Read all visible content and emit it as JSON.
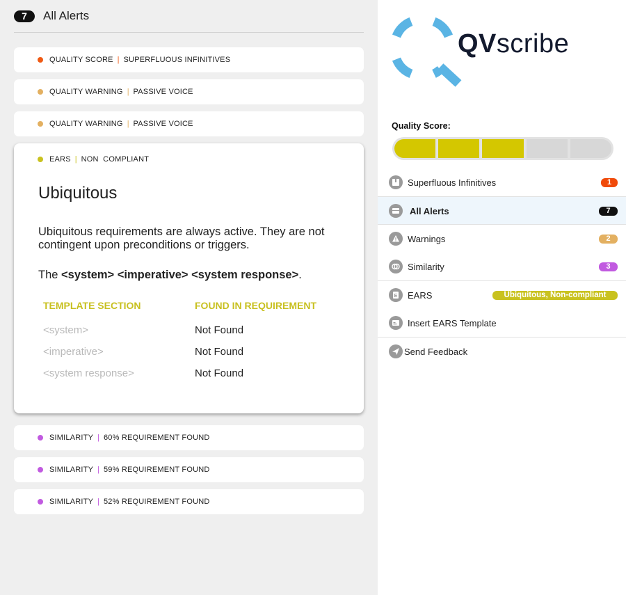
{
  "header": {
    "count": "7",
    "title": "All Alerts"
  },
  "colors": {
    "quality_score": "#f05a14",
    "warning": "#e3b061",
    "ears": "#c9c21f",
    "similarity": "#c15ae0",
    "score_filled": "#d4c700",
    "score_empty": "#d7d7d7"
  },
  "alerts": [
    {
      "category": "QUALITY SCORE",
      "detail": "SUPERFLUOUS INFINITIVES",
      "kind": "quality_score"
    },
    {
      "category": "QUALITY WARNING",
      "detail": "PASSIVE VOICE",
      "kind": "warning"
    },
    {
      "category": "QUALITY WARNING",
      "detail": "PASSIVE VOICE",
      "kind": "warning"
    },
    {
      "category": "SIMILARITY",
      "detail": "60% REQUIREMENT FOUND",
      "kind": "similarity"
    },
    {
      "category": "SIMILARITY",
      "detail": "59% REQUIREMENT FOUND",
      "kind": "similarity"
    },
    {
      "category": "SIMILARITY",
      "detail": "52% REQUIREMENT FOUND",
      "kind": "similarity"
    }
  ],
  "expanded": {
    "category": "EARS",
    "detail": "NON  COMPLIANT",
    "title": "Ubiquitous",
    "description": "Ubiquitous requirements are always active. They are not contingent upon preconditions or triggers.",
    "pattern_prefix": "The ",
    "pattern_bold": "<system> <imperative> <system response>",
    "pattern_suffix": ".",
    "table": {
      "col1": "TEMPLATE SECTION",
      "col2": "FOUND IN REQUIREMENT",
      "rows": [
        {
          "section": "<system>",
          "found": "Not Found"
        },
        {
          "section": "<imperative>",
          "found": "Not Found"
        },
        {
          "section": "<system response>",
          "found": "Not Found"
        }
      ]
    }
  },
  "sidebar": {
    "brand_bold": "QV",
    "brand_rest": "scribe",
    "quality_label": "Quality Score:",
    "quality_score": {
      "filled": 3,
      "total": 5
    },
    "items": [
      {
        "label": "Superfluous Infinitives",
        "badge": "1",
        "badge_color": "#f04a0a",
        "icon": "document-icon"
      },
      {
        "label": "All Alerts",
        "badge": "7",
        "badge_color": "#111111",
        "icon": "inbox-icon"
      },
      {
        "label": "Warnings",
        "badge": "2",
        "badge_color": "#e3b061",
        "icon": "warning-icon"
      },
      {
        "label": "Similarity",
        "badge": "3",
        "badge_color": "#c15ae0",
        "icon": "similarity-icon"
      },
      {
        "label": "EARS",
        "badge": "Ubiquitous, Non-compliant",
        "badge_color": "#c9c21f",
        "icon": "ears-icon"
      },
      {
        "label": "Insert EARS Template",
        "icon": "template-icon"
      },
      {
        "label": "Send Feedback",
        "icon": "send-icon"
      }
    ]
  }
}
